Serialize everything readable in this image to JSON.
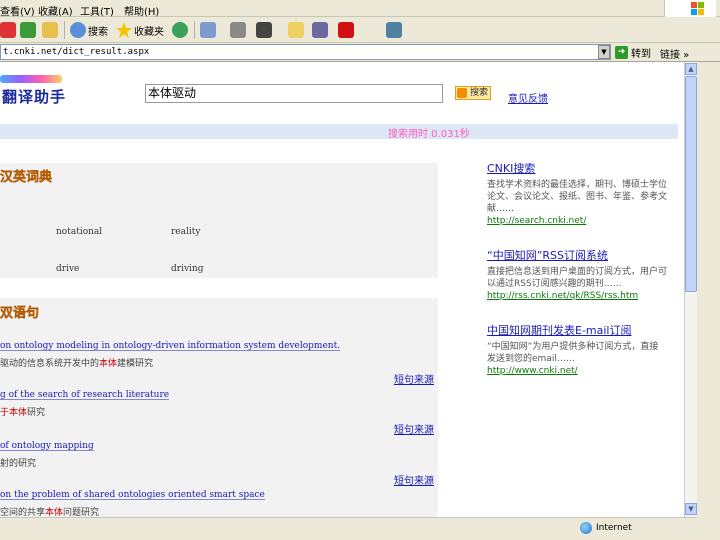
{
  "menubar": {
    "items": [
      "查看(V)",
      "收藏(A)",
      "工具(T)",
      "帮助(H)"
    ]
  },
  "toolbar": {
    "search_label": "搜索",
    "favorites_label": "收藏夹"
  },
  "address": {
    "url": "t.cnki.net/dict_result.aspx",
    "go_label": "转到",
    "links_label": "链接 »"
  },
  "page": {
    "logo_text": "翻译助手",
    "search_value": "本体驱动",
    "search_button": "搜索",
    "feedback_link": "意见反馈",
    "time_text": "搜索用时 0.031秒",
    "dict_title": "汉英词典",
    "dict_words": [
      "notational",
      "reality",
      "drive",
      "driving"
    ],
    "sentence_title": "双语句",
    "sentences": [
      {
        "en": "on ontology modeling in ontology-driven information system development.",
        "cn_before": "驱动的信息系统开发中的",
        "cn_hl": "本体",
        "cn_after": "建模研究",
        "source": "短句来源"
      },
      {
        "en": "g of the search of research literature",
        "cn_before": "",
        "cn_hl": "于本体",
        "cn_after": "研究",
        "source": "短句来源"
      },
      {
        "en": "of ontology mapping",
        "cn_before": "射的研究",
        "cn_hl": "",
        "cn_after": "",
        "source": "短句来源"
      },
      {
        "en": "on the problem of shared ontologies oriented smart space",
        "cn_before": "空间的共享",
        "cn_hl": "本体",
        "cn_after": "问题研究",
        "source": ""
      }
    ]
  },
  "ads": [
    {
      "title": "CNKI搜索",
      "desc": "查找学术资料的最佳选择，期刊、博硕士学位论文、会议论文、报纸、图书、年鉴、参考文献……",
      "url": "http://search.cnki.net/"
    },
    {
      "title": "“中国知网”RSS订阅系统",
      "desc": "直接把信息送到用户桌面的订阅方式，用户可以通过RSS订阅感兴趣的期刊……",
      "url": "http://rss.cnki.net/qk/RSS/rss.htm"
    },
    {
      "title": "中国知网期刊发表E-mail订阅",
      "desc": "“中国知网”为用户提供多种订阅方式，直接发送到您的email……",
      "url": "http://www.cnki.net/"
    }
  ],
  "status": {
    "zone": "Internet"
  }
}
